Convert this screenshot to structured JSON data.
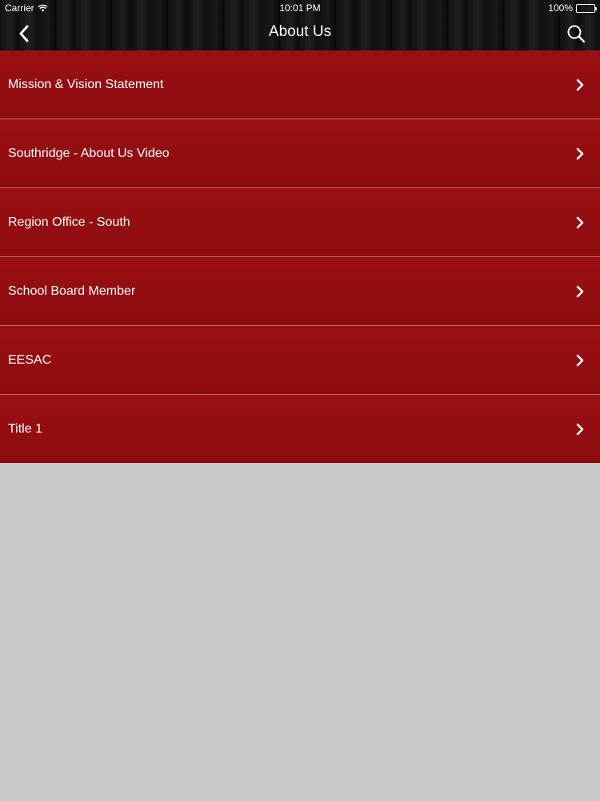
{
  "status_bar": {
    "carrier": "Carrier",
    "time": "10:01 PM",
    "battery": "100%"
  },
  "nav": {
    "title": "About Us",
    "back_icon": "chevron-left-icon",
    "search_icon": "search-icon"
  },
  "menu": {
    "items": [
      {
        "label": "Mission & Vision Statement"
      },
      {
        "label": "Southridge - About Us Video"
      },
      {
        "label": "Region Office - South"
      },
      {
        "label": "School Board Member"
      },
      {
        "label": "EESAC"
      },
      {
        "label": "Title 1"
      }
    ]
  },
  "colors": {
    "menu_background": "#920e11",
    "divider": "#c86a6c",
    "page_background": "#c8c8ca",
    "topbar_background": "#141414"
  }
}
